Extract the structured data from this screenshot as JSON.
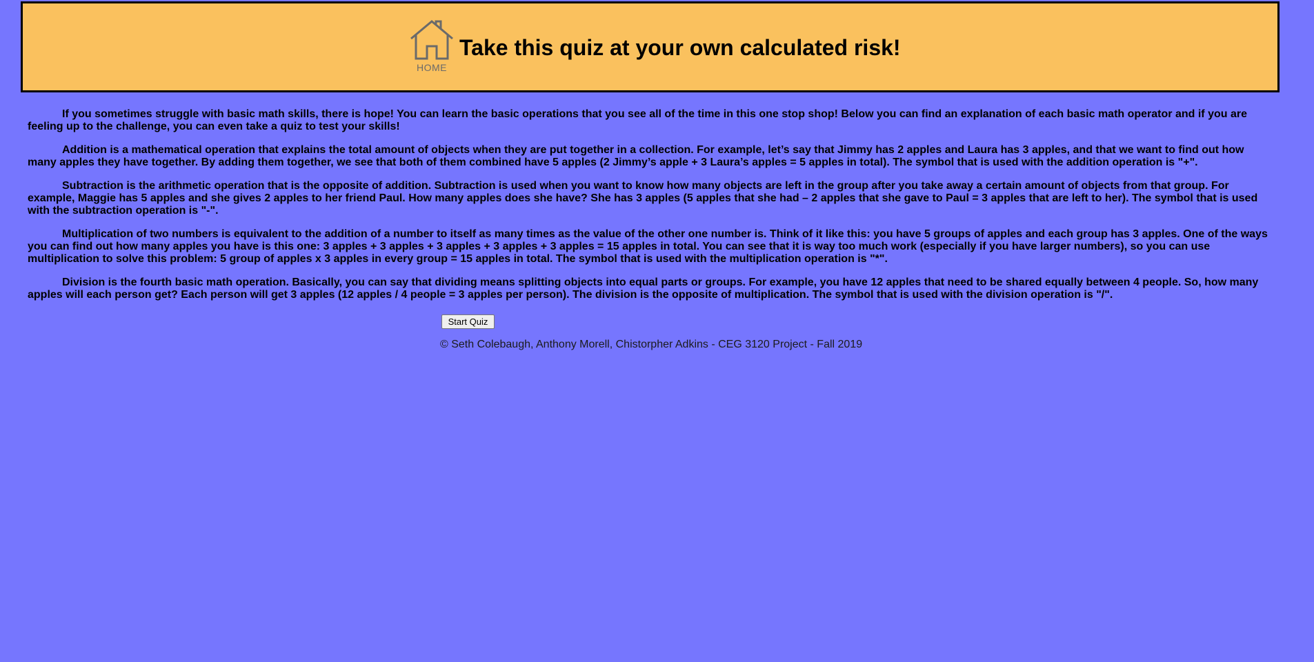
{
  "header": {
    "home_label": "HOME",
    "home_icon": "house-icon",
    "title": "Take this quiz at your own calculated risk!"
  },
  "content": {
    "paragraphs": [
      "If you sometimes struggle with basic math skills, there is hope! You can learn the basic operations that you see all of the time in this one stop shop! Below you can find an explanation of each basic math operator and if you are feeling up to the challenge, you can even take a quiz to test your skills!",
      "Addition is a mathematical operation that explains the total amount of objects when they are put together in a collection. For example, let’s say that Jimmy has 2 apples and Laura has 3 apples, and that we want to find out how many apples they have together. By adding them together, we see that both of them combined have 5 apples (2 Jimmy’s apple + 3 Laura’s apples = 5 apples in total). The symbol that is used with the addition operation is \"+\".",
      "Subtraction is the arithmetic operation that is the opposite of addition. Subtraction is used when you want to know how many objects are left in the group after you take away a certain amount of objects from that group. For example, Maggie has 5 apples and she gives 2 apples to her friend Paul. How many apples does she have? She has 3 apples (5 apples that she had – 2 apples that she gave to Paul = 3 apples that are left to her). The symbol that is used with the subtraction operation is \"-\".",
      "Multiplication of two numbers is equivalent to the addition of a number to itself as many times as the value of the other one number is. Think of it like this: you have 5 groups of apples and each group has 3 apples. One of the ways you can find out how many apples you have is this one: 3 apples + 3 apples + 3 apples + 3 apples + 3 apples = 15 apples in total. You can see that it is way too much work (especially if you have larger numbers), so you can use multiplication to solve this problem: 5 group of apples x 3 apples in every group = 15 apples in total. The symbol that is used with the multiplication operation is \"*\".",
      "Division is the fourth basic math operation. Basically, you can say that dividing means splitting objects into equal parts or groups. For example, you have 12 apples that need to be shared equally between 4 people. So, how many apples will each person get? Each person will get 3 apples (12 apples / 4 people = 3 apples per person). The division is the opposite of multiplication. The symbol that is used with the division operation is \"/\"."
    ]
  },
  "quiz": {
    "start_label": "Start Quiz"
  },
  "footer": {
    "copyright": "© Seth Colebaugh, Anthony Morell, Chistorpher Adkins - CEG 3120 Project - Fall 2019"
  },
  "colors": {
    "page_background": "#7676fe",
    "header_background": "#fac15e",
    "header_border": "#000000",
    "home_icon_color": "#6a6a6a"
  }
}
